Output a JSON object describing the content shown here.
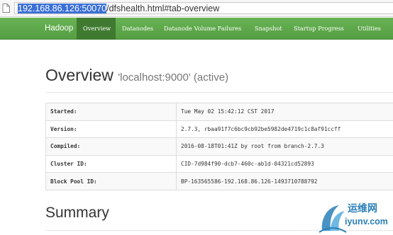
{
  "browser": {
    "url_selected": "192.168.86.126:50070",
    "url_rest": "/dfshealth.html#tab-overview"
  },
  "nav": {
    "brand": "Hadoop",
    "items": [
      {
        "label": "Overview",
        "active": true
      },
      {
        "label": "Datanodes",
        "active": false
      },
      {
        "label": "Datanode Volume Failures",
        "active": false
      },
      {
        "label": "Snapshot",
        "active": false
      },
      {
        "label": "Startup Progress",
        "active": false
      },
      {
        "label": "Utilities",
        "active": false
      }
    ]
  },
  "overview": {
    "title": "Overview",
    "subtitle": "'localhost:9000' (active)",
    "rows": [
      {
        "key": "Started:",
        "value": "Tue May 02 15:42:12 CST 2017"
      },
      {
        "key": "Version:",
        "value": "2.7.3, rbaa91f7c6bc9cb92be5982de4719c1c8af91ccff"
      },
      {
        "key": "Compiled:",
        "value": "2016-08-18T01:41Z by root from branch-2.7.3"
      },
      {
        "key": "Cluster ID:",
        "value": "CID-7d984f90-dcb7-460c-ab1d-04321cd52893"
      },
      {
        "key": "Block Pool ID:",
        "value": "BP-163565586-192.168.86.126-1493710788792"
      }
    ]
  },
  "summary": {
    "title": "Summary"
  },
  "watermark": {
    "text_cn": "运维网",
    "url": "iyunv.com"
  },
  "colors": {
    "nav_green": "#5aa548",
    "nav_active": "#3f7a30",
    "watermark_blue": "#2a7fb8"
  }
}
